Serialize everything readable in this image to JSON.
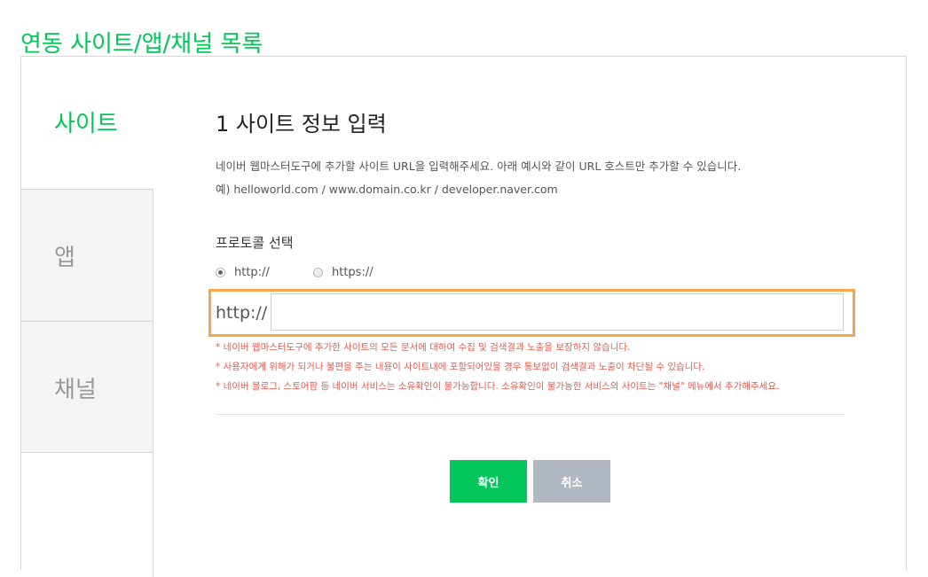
{
  "page": {
    "title": "연동 사이트/앱/채널 목록"
  },
  "tabs": [
    {
      "label": "사이트",
      "active": true
    },
    {
      "label": "앱",
      "active": false
    },
    {
      "label": "채널",
      "active": false
    }
  ],
  "form": {
    "step_title": "1 사이트 정보 입력",
    "description_1": "네이버 웹마스터도구에 추가할 사이트 URL을 입력해주세요. 아래 예시와 같이 URL 호스트만 추가할 수 있습니다.",
    "description_2": "예) helloworld.com / www.domain.co.kr / developer.naver.com",
    "protocol_label": "프로토콜 선택",
    "protocols": [
      {
        "label": "http://",
        "selected": true
      },
      {
        "label": "https://",
        "selected": false
      }
    ],
    "url_prefix": "http://",
    "url_value": "",
    "notices": [
      "* 네이버 웹마스터도구에 추가한 사이트의 모든 문서에 대하여 수집 및 검색결과 노출을 보장하지 않습니다.",
      "* 사용자에게 위해가 되거나 불편을 주는 내용이 사이트내에 포함되어있을 경우 통보없이 검색결과 노출이 차단될 수 있습니다.",
      "* 네이버 블로그, 스토어팜 등 네이버 서비스는 소유확인이 불가능합니다. 소유확인이 불가능한 서비스의 사이트는 \"채널\" 메뉴에서 추가해주세요."
    ],
    "confirm_label": "확인",
    "cancel_label": "취소"
  },
  "colors": {
    "brand": "#03c75a",
    "highlight": "#f8a44b",
    "notice": "#ea5a4a",
    "cancel": "#b1b8c2"
  }
}
